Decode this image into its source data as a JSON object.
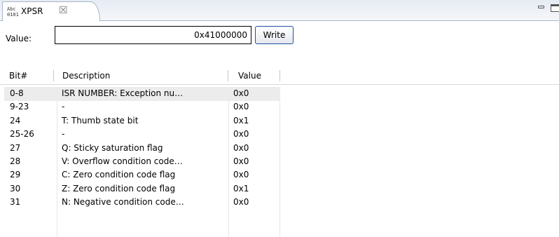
{
  "tab": {
    "icon_text": "Abc 0101",
    "title": "XPSR",
    "close_glyph": "☒"
  },
  "value_field": {
    "label": "Value:",
    "value": "0x41000000",
    "write_label": "Write"
  },
  "table": {
    "columns": [
      "Bit#",
      "Description",
      "Value"
    ],
    "rows": [
      {
        "bit": "0-8",
        "description": "ISR NUMBER: Exception nu…",
        "value": "0x0"
      },
      {
        "bit": "9-23",
        "description": "-",
        "value": "0x0"
      },
      {
        "bit": "24",
        "description": "T: Thumb state bit",
        "value": "0x1"
      },
      {
        "bit": "25-26",
        "description": "-",
        "value": "0x0"
      },
      {
        "bit": "27",
        "description": "Q: Sticky saturation flag",
        "value": "0x0"
      },
      {
        "bit": "28",
        "description": "V: Overflow condition code…",
        "value": "0x0"
      },
      {
        "bit": "29",
        "description": "C: Zero condition code flag",
        "value": "0x0"
      },
      {
        "bit": "30",
        "description": "Z: Zero condition code flag",
        "value": "0x1"
      },
      {
        "bit": "31",
        "description": "N: Negative condition code…",
        "value": "0x0"
      }
    ]
  }
}
